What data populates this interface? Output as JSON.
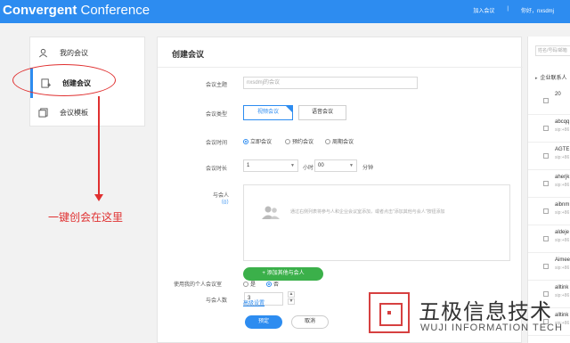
{
  "header": {
    "brand_bold": "Convergent",
    "brand_rest": " Conference",
    "join_meeting": "加入会议",
    "separator": "|",
    "greeting": "你好，nxsdmj",
    "bg_color": "#2d8cf0"
  },
  "sidebar": {
    "items": [
      {
        "label": "我的会议",
        "icon": "user-icon"
      },
      {
        "label": "创建会议",
        "icon": "create-meeting-icon"
      },
      {
        "label": "会议模板",
        "icon": "template-icon"
      }
    ]
  },
  "annotation": {
    "text": "一键创会在这里"
  },
  "form": {
    "title": "创建会议",
    "subject_label": "会议主题",
    "subject_placeholder": "nxsdmj的会议",
    "type_label": "会议类型",
    "type_options": [
      "视频会议",
      "语音会议"
    ],
    "time_label": "会议时间",
    "time_options": [
      "立即会议",
      "预约会议",
      "周期会议"
    ],
    "duration_label": "会议时长",
    "duration_hours": "1",
    "hours_unit": "小时",
    "duration_minutes": "00",
    "minutes_unit": "分钟",
    "participants_label": "与会人",
    "participants_count": "（0）",
    "participants_hint": "通过右侧列表将参与人和企业会议室添加，或者点击\"添加其他与会人\"按钮添加",
    "add_button": "+ 添加其他与会人",
    "count_label": "与会人数",
    "count_value": "3",
    "spin_up": "▲",
    "spin_down": "▼",
    "personal_room_label": "使用我的个人会议室",
    "personal_room_options": [
      "是",
      "否"
    ],
    "advanced_link": "高级设置",
    "ok_button": "预定",
    "cancel_button": "取消"
  },
  "contacts": {
    "search_placeholder": "姓名/号码/邮箱",
    "group_label": "企业联系人",
    "rows": [
      {
        "name": "20",
        "sub": ""
      },
      {
        "name": "abcqq",
        "sub": "sip:+86"
      },
      {
        "name": "AGTE",
        "sub": "sip:+86"
      },
      {
        "name": "aherjk",
        "sub": "sip:+86"
      },
      {
        "name": "aibnm",
        "sub": "sip:+86"
      },
      {
        "name": "aldeje",
        "sub": "sip:+86"
      },
      {
        "name": "Aimee",
        "sub": "sip:+86"
      },
      {
        "name": "alltink",
        "sub": "sip:+86"
      },
      {
        "name": "alltink",
        "sub": "sip:+86"
      }
    ]
  },
  "watermark": {
    "cn": "五极信息技术",
    "en": "WUJI INFORMATION TECH"
  }
}
